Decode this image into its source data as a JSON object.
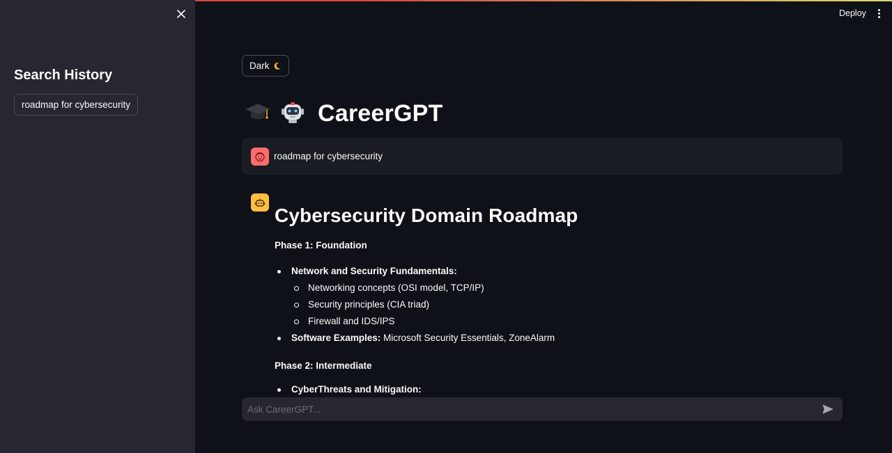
{
  "header": {
    "deploy_label": "Deploy",
    "menu_icon": "kebab-menu-icon"
  },
  "sidebar": {
    "close_icon": "close-icon",
    "title": "Search History",
    "history": [
      {
        "label": "roadmap for cybersecurity"
      }
    ]
  },
  "main": {
    "theme_button": {
      "label": "Dark",
      "icon": "moon-icon"
    },
    "title": "CareerGPT",
    "title_icons": [
      "graduation-cap-icon",
      "robot-icon"
    ],
    "user_message": {
      "avatar": "user-avatar-icon",
      "text": "roadmap for cybersecurity"
    },
    "assistant": {
      "avatar": "bot-avatar-icon",
      "heading": "Cybersecurity Domain Roadmap",
      "phase1": {
        "title": "Phase 1: Foundation",
        "item1_label": "Network and Security Fundamentals:",
        "subitems": [
          "Networking concepts (OSI model, TCP/IP)",
          "Security principles (CIA triad)",
          "Firewall and IDS/IPS"
        ],
        "item2_label": "Software Examples:",
        "item2_text": " Microsoft Security Essentials, ZoneAlarm"
      },
      "phase2": {
        "title": "Phase 2: Intermediate",
        "item1_label": "CyberThreats and Mitigation:"
      }
    },
    "chat_input": {
      "placeholder": "Ask CareerGPT...",
      "send_icon": "send-icon"
    }
  },
  "colors": {
    "background": "#0e1117",
    "sidebar": "#262730",
    "user_avatar": "#ff6c6c",
    "bot_avatar": "#ffbd45",
    "text": "#fafafa"
  }
}
